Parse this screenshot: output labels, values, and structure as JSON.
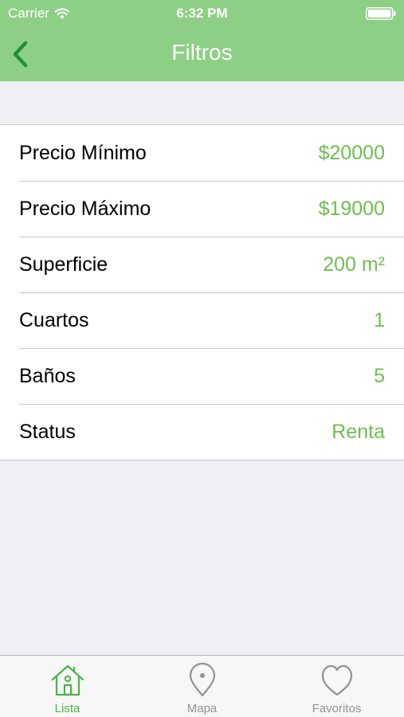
{
  "status_bar": {
    "carrier": "Carrier",
    "time": "6:32 PM"
  },
  "nav": {
    "title": "Filtros",
    "back_icon": "chevron-left-icon"
  },
  "filters": [
    {
      "label": "Precio Mínimo",
      "value": "$20000"
    },
    {
      "label": "Precio Máximo",
      "value": "$19000"
    },
    {
      "label": "Superficie",
      "value": "200 m²"
    },
    {
      "label": "Cuartos",
      "value": "1"
    },
    {
      "label": "Baños",
      "value": "5"
    },
    {
      "label": "Status",
      "value": "Renta"
    }
  ],
  "tabs": [
    {
      "label": "Lista",
      "icon": "house-icon",
      "active": true
    },
    {
      "label": "Mapa",
      "icon": "map-pin-icon",
      "active": false
    },
    {
      "label": "Favoritos",
      "icon": "heart-icon",
      "active": false
    }
  ],
  "colors": {
    "nav_green": "#8ecf86",
    "value_green": "#6cbf4f",
    "active_tab": "#4ab54a",
    "inactive_tab": "#929292",
    "background": "#efeff4"
  }
}
